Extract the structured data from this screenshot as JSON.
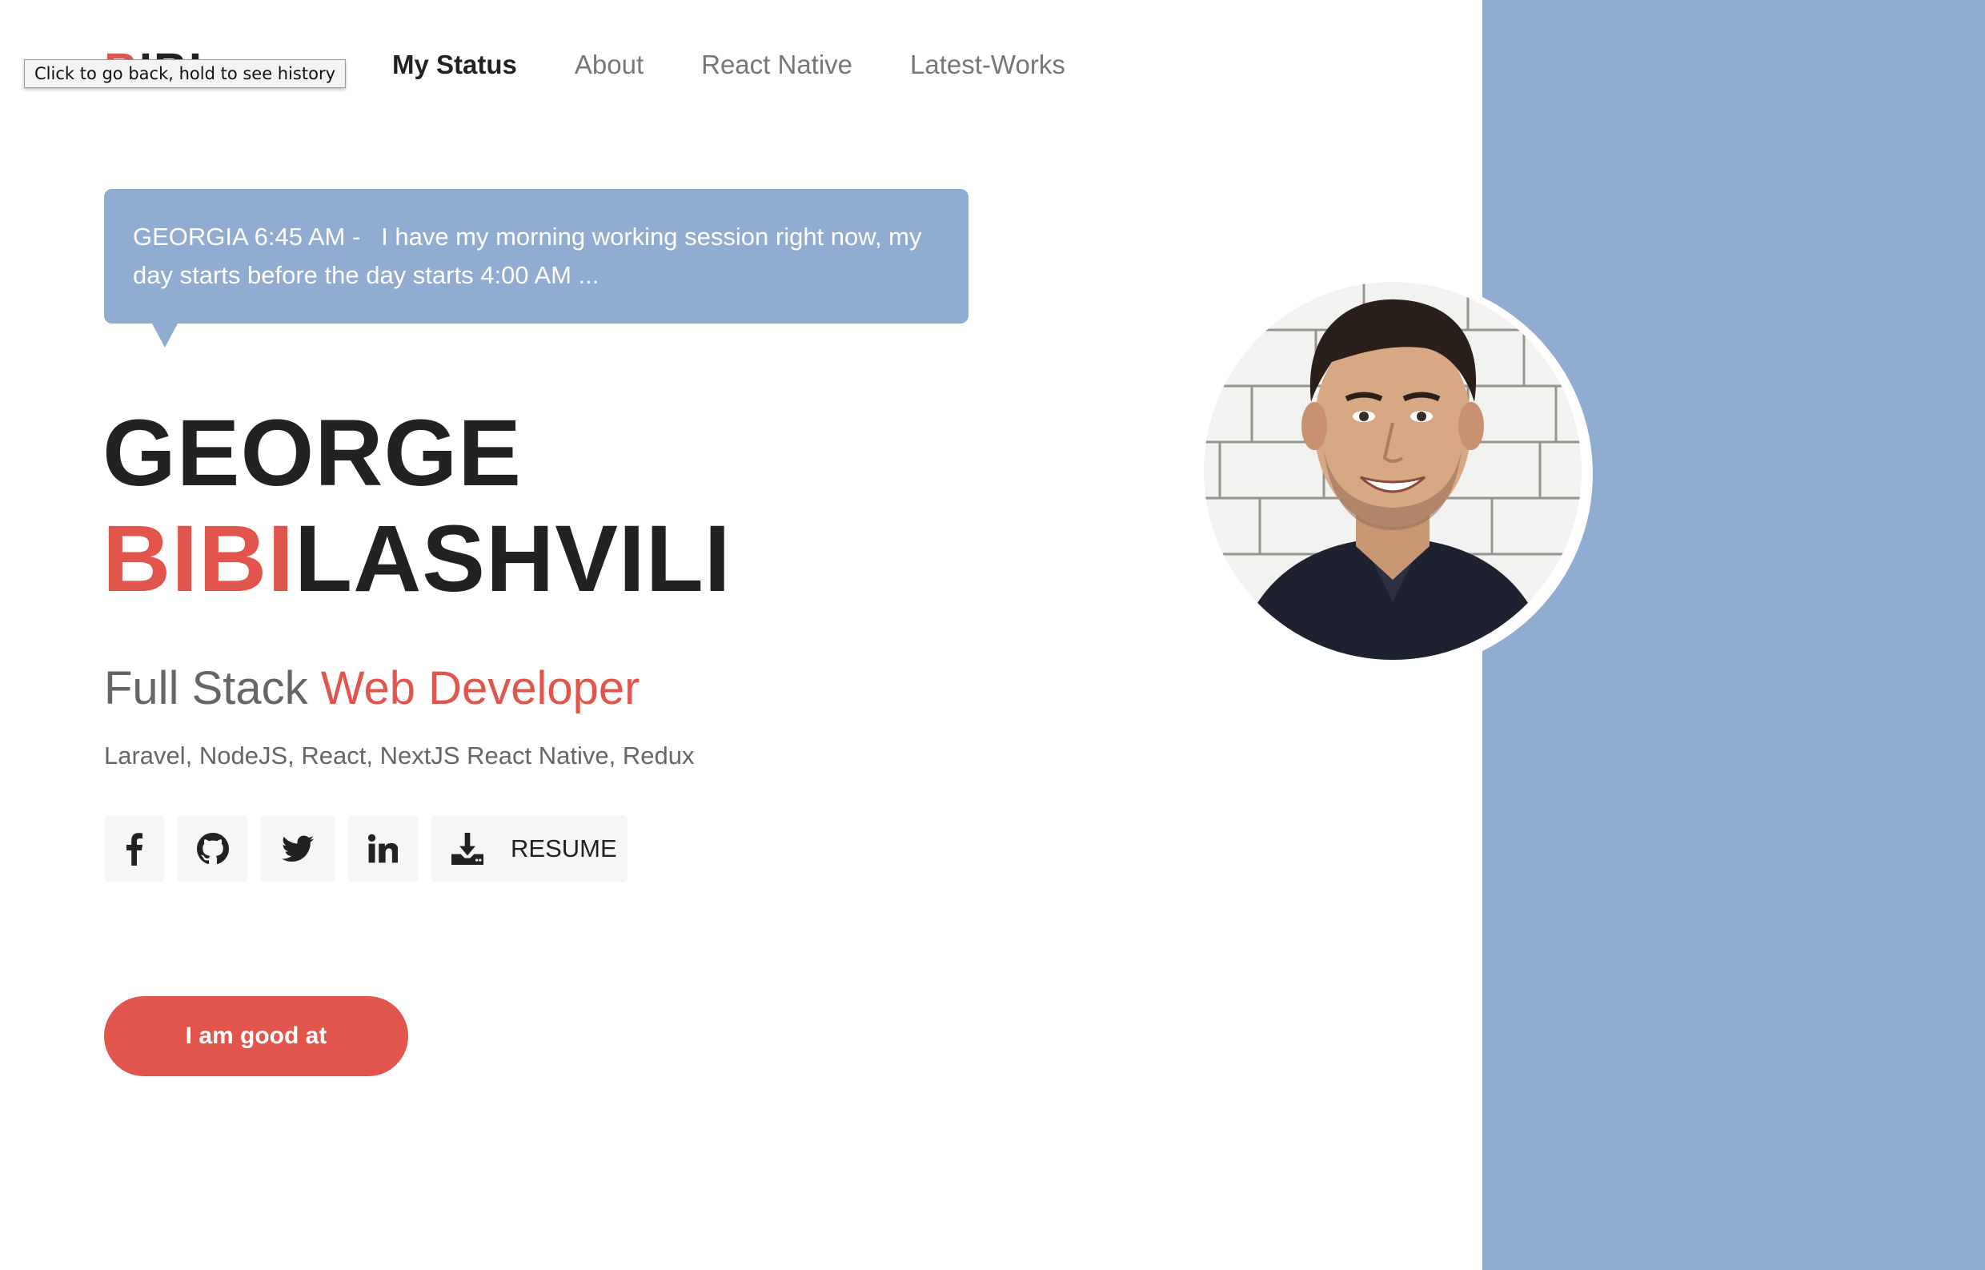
{
  "logo": {
    "red_part": "B",
    "dark_part": "IBI"
  },
  "tooltip": "Click to go back, hold to see history",
  "nav": {
    "items": [
      {
        "label": "My Status",
        "active": true
      },
      {
        "label": "About",
        "active": false
      },
      {
        "label": "React Native",
        "active": false
      },
      {
        "label": "Latest-Works",
        "active": false
      }
    ]
  },
  "status": {
    "line1": "GEORGIA 6:45 AM -   I have my morning working session right now, my",
    "line2": "day starts before the day starts 4:00 AM ..."
  },
  "hero": {
    "first_name": "GEORGE",
    "last_name_red": "BIBI",
    "last_name_rest": "LASHVILI",
    "role_plain": "Full Stack ",
    "role_red": "Web Developer",
    "skills": "Laravel, NodeJS, React, NextJS React Native, Redux"
  },
  "socials": {
    "facebook_icon": "facebook-icon",
    "github_icon": "github-icon",
    "twitter_icon": "twitter-icon",
    "linkedin_icon": "linkedin-icon",
    "download_icon": "download-icon",
    "resume_label": "RESUME"
  },
  "cta": {
    "label": "I am good at"
  },
  "colors": {
    "accent_red": "#e2554d",
    "panel_blue": "#90acd1",
    "text_dark": "#222222",
    "text_muted": "#666666"
  }
}
